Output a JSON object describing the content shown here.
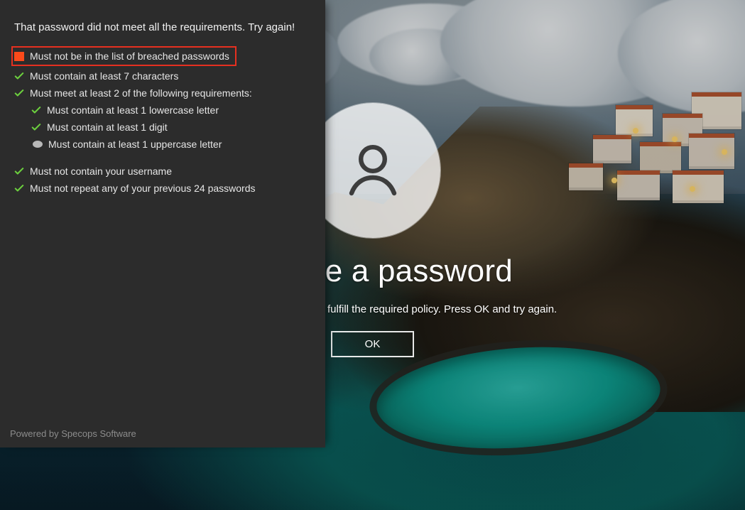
{
  "center": {
    "title": "Change a password",
    "message": "Your new password does not fulfill the required policy. Press OK and try again.",
    "ok_label": "OK"
  },
  "panel": {
    "heading": "That password did not meet all the requirements. Try again!",
    "footer": "Powered by Specops Software",
    "rules": {
      "breached": "Must not be in the list of breached passwords",
      "min_len": "Must contain at least 7 characters",
      "two_of": "Must meet at least 2 of the following requirements:",
      "lowercase": "Must contain at least 1 lowercase letter",
      "digit": "Must contain at least 1 digit",
      "uppercase": "Must contain at least 1 uppercase letter",
      "username": "Must not contain your username",
      "history": "Must not repeat any of your previous 24 passwords"
    }
  },
  "colors": {
    "fail_accent": "#fc4a1a",
    "pass_accent": "#6ccf3e",
    "highlight_border": "#e63020"
  }
}
